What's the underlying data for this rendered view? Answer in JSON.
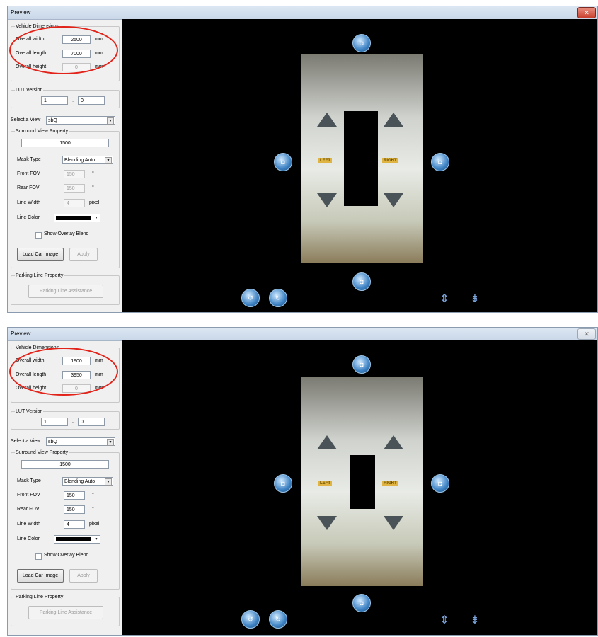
{
  "windows": [
    {
      "title": "Preview",
      "vehicle_dimensions": {
        "legend": "Vehicle Dimensions",
        "overall_width_label": "Overall width",
        "overall_width": "2500",
        "overall_width_unit": "mm",
        "overall_length_label": "Overall length",
        "overall_length": "7000",
        "overall_length_unit": "mm",
        "overall_height_label": "Overall height",
        "overall_height": "0",
        "overall_height_unit": "mm"
      },
      "lut": {
        "legend": "LUT Version",
        "major": "1",
        "sep": ",",
        "minor": "0"
      },
      "select_view": {
        "label": "Select a View",
        "value": "sbQ"
      },
      "surround": {
        "legend": "Surround View Property",
        "value": "1500",
        "mask_type_label": "Mask Type",
        "mask_type": "Blending Auto",
        "front_fov_label": "Front FOV",
        "front_fov": "150",
        "front_fov_unit": "°",
        "rear_fov_label": "Rear FOV",
        "rear_fov": "150",
        "rear_fov_unit": "°",
        "line_width_label": "Line Width",
        "line_width": "4",
        "line_width_unit": "pixel",
        "line_color_label": "Line Color",
        "overlay_label": "Show Overlay Blend",
        "load_car_image": "Load Car Image",
        "apply": "Apply"
      },
      "parking": {
        "legend": "Parking Line Property",
        "assist": "Parking Line Assistance"
      },
      "preview": {
        "left": "LEFT",
        "right": "RIGHT"
      },
      "inputs_disabled": true
    },
    {
      "title": "Preview",
      "vehicle_dimensions": {
        "legend": "Vehicle Dimensions",
        "overall_width_label": "Overall width",
        "overall_width": "1900",
        "overall_width_unit": "mm",
        "overall_length_label": "Overall length",
        "overall_length": "3950",
        "overall_length_unit": "mm",
        "overall_height_label": "Overall height",
        "overall_height": "0",
        "overall_height_unit": "mm"
      },
      "lut": {
        "legend": "LUT Version",
        "major": "1",
        "sep": ",",
        "minor": "0"
      },
      "select_view": {
        "label": "Select a View",
        "value": "sbQ"
      },
      "surround": {
        "legend": "Surround View Property",
        "value": "1500",
        "mask_type_label": "Mask Type",
        "mask_type": "Blending Auto",
        "front_fov_label": "Front FOV",
        "front_fov": "150",
        "front_fov_unit": "°",
        "rear_fov_label": "Rear FOV",
        "rear_fov": "150",
        "rear_fov_unit": "°",
        "line_width_label": "Line Width",
        "line_width": "4",
        "line_width_unit": "pixel",
        "line_color_label": "Line Color",
        "overlay_label": "Show Overlay Blend",
        "load_car_image": "Load Car Image",
        "apply": "Apply"
      },
      "parking": {
        "legend": "Parking Line Property",
        "assist": "Parking Line Assistance"
      },
      "preview": {
        "left": "LEFT",
        "right": "RIGHT"
      },
      "inputs_disabled": false
    }
  ],
  "icons": {
    "close": "close-icon",
    "camera": "camera-icon",
    "rotate_ccw": "rotate-ccw-icon",
    "rotate_cw": "rotate-cw-icon",
    "expand_vertical": "expand-vertical-icon",
    "collapse_vertical": "collapse-vertical-icon"
  },
  "colors": {
    "highlight": "#e2231a",
    "line_color": "#000000",
    "label_yellow": "#e0b442"
  }
}
